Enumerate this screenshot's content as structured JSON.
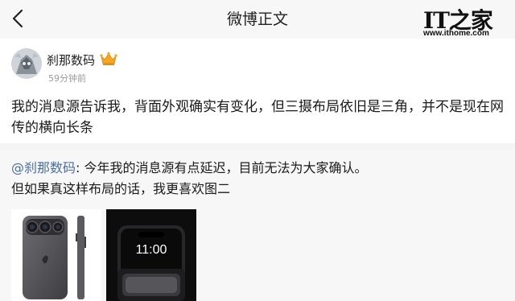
{
  "header": {
    "title": "微博正文"
  },
  "watermark": {
    "logo": "IT之家",
    "url": "www.ithome.com"
  },
  "author": {
    "name": "刹那数码",
    "time": "59分钟前"
  },
  "post": {
    "text": "我的消息源告诉我，背面外观确实有变化，但三摄布局依旧是三角，并不是现在网传的横向长条"
  },
  "repost": {
    "mention": "@刹那数码",
    "line1": ": 今年我的消息源有点延迟，目前无法为大家确认。",
    "line2": "但如果真这样布局的话，我更喜欢图二"
  },
  "images": {
    "clock": "11:00"
  },
  "colors": {
    "link": "#4a6ea0",
    "nav_bg": "#f7f7f7",
    "repost_bg": "#f7f7f7"
  },
  "icons": [
    "back-arrow-icon",
    "crown-badge-icon"
  ]
}
